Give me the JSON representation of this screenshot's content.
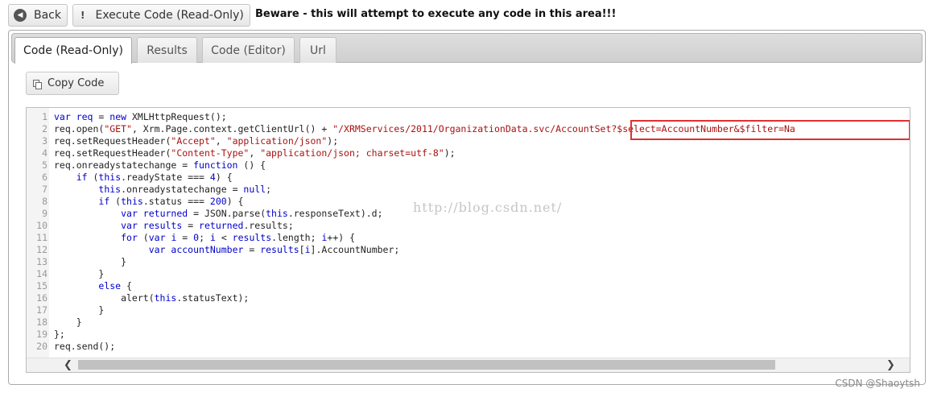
{
  "toolbar": {
    "back_label": "Back",
    "execute_label": "Execute Code (Read-Only)",
    "warning": "Beware - this will attempt to execute any code in this area!!!"
  },
  "tabs": [
    {
      "label": "Code (Read-Only)",
      "active": true
    },
    {
      "label": "Results",
      "active": false
    },
    {
      "label": "Code (Editor)",
      "active": false
    },
    {
      "label": "Url",
      "active": false
    }
  ],
  "copy_label": "Copy Code",
  "code_lines": [
    [
      [
        "var ",
        "kw"
      ],
      [
        "req",
        "kw"
      ],
      [
        " = ",
        ""
      ],
      [
        "new",
        "kw"
      ],
      [
        " XMLHttpRequest();",
        ""
      ]
    ],
    [
      [
        "req.open(",
        ""
      ],
      [
        "\"GET\"",
        "str"
      ],
      [
        ", Xrm.Page.context.getClientUrl() + ",
        ""
      ],
      [
        "\"/XRMServices/2011/OrganizationData.svc/AccountSet?$select=AccountNumber&$filter=Na",
        "str"
      ]
    ],
    [
      [
        "req.setRequestHeader(",
        ""
      ],
      [
        "\"Accept\"",
        "str"
      ],
      [
        ", ",
        ""
      ],
      [
        "\"application/json\"",
        "str"
      ],
      [
        ");",
        ""
      ]
    ],
    [
      [
        "req.setRequestHeader(",
        ""
      ],
      [
        "\"Content-Type\"",
        "str"
      ],
      [
        ", ",
        ""
      ],
      [
        "\"application/json; charset=utf-8\"",
        "str"
      ],
      [
        ");",
        ""
      ]
    ],
    [
      [
        "req.onreadystatechange = ",
        ""
      ],
      [
        "function",
        "kw"
      ],
      [
        " () {",
        ""
      ]
    ],
    [
      [
        "    ",
        ""
      ],
      [
        "if",
        "kw"
      ],
      [
        " (",
        ""
      ],
      [
        "this",
        "kw"
      ],
      [
        ".readyState === ",
        ""
      ],
      [
        "4",
        "kw"
      ],
      [
        ") {",
        ""
      ]
    ],
    [
      [
        "        ",
        ""
      ],
      [
        "this",
        "kw"
      ],
      [
        ".onreadystatechange = ",
        ""
      ],
      [
        "null",
        "kw"
      ],
      [
        ";",
        ""
      ]
    ],
    [
      [
        "        ",
        ""
      ],
      [
        "if",
        "kw"
      ],
      [
        " (",
        ""
      ],
      [
        "this",
        "kw"
      ],
      [
        ".status === ",
        ""
      ],
      [
        "200",
        "kw"
      ],
      [
        ") {",
        ""
      ]
    ],
    [
      [
        "            ",
        ""
      ],
      [
        "var ",
        "kw"
      ],
      [
        "returned",
        "kw"
      ],
      [
        " = JSON.parse(",
        ""
      ],
      [
        "this",
        "kw"
      ],
      [
        ".responseText).d;",
        ""
      ]
    ],
    [
      [
        "            ",
        ""
      ],
      [
        "var ",
        "kw"
      ],
      [
        "results",
        "kw"
      ],
      [
        " = ",
        ""
      ],
      [
        "returned",
        "kw"
      ],
      [
        ".results;",
        ""
      ]
    ],
    [
      [
        "            ",
        ""
      ],
      [
        "for",
        "kw"
      ],
      [
        " (",
        ""
      ],
      [
        "var ",
        "kw"
      ],
      [
        "i",
        "kw"
      ],
      [
        " = ",
        ""
      ],
      [
        "0",
        "kw"
      ],
      [
        "; ",
        ""
      ],
      [
        "i",
        "kw"
      ],
      [
        " < ",
        ""
      ],
      [
        "results",
        "kw"
      ],
      [
        ".length; ",
        ""
      ],
      [
        "i",
        "kw"
      ],
      [
        "++) {",
        ""
      ]
    ],
    [
      [
        "                 ",
        ""
      ],
      [
        "var ",
        "kw"
      ],
      [
        "accountNumber",
        "kw"
      ],
      [
        " = ",
        ""
      ],
      [
        "results",
        "kw"
      ],
      [
        "[",
        ""
      ],
      [
        "i",
        "kw"
      ],
      [
        "].AccountNumber;",
        ""
      ]
    ],
    [
      [
        "            }",
        ""
      ]
    ],
    [
      [
        "        }",
        ""
      ]
    ],
    [
      [
        "        ",
        ""
      ],
      [
        "else",
        "kw"
      ],
      [
        " {",
        ""
      ]
    ],
    [
      [
        "            alert(",
        ""
      ],
      [
        "this",
        "kw"
      ],
      [
        ".statusText);",
        ""
      ]
    ],
    [
      [
        "        }",
        ""
      ]
    ],
    [
      [
        "    }",
        ""
      ]
    ],
    [
      [
        "};",
        ""
      ]
    ],
    [
      [
        "req.send();",
        ""
      ]
    ]
  ],
  "watermark": "http://blog.csdn.net/",
  "credit": "CSDN @Shaoytsh",
  "colors": {
    "keyword": "#0000cc",
    "string": "#aa1111",
    "highlight_box": "#e03030"
  }
}
